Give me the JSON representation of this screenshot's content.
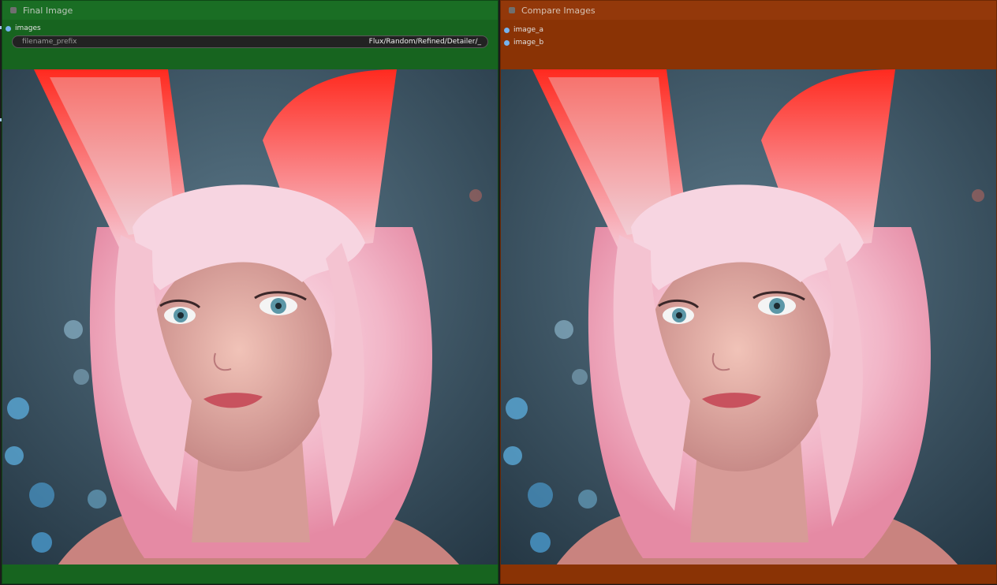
{
  "final_node": {
    "title": "Final Image",
    "input_slot": "images",
    "widget": {
      "name": "filename_prefix",
      "value": "Flux/Random/Refined/Detailer/_"
    },
    "preview_image": "portrait-pink-hair-fox-ears"
  },
  "compare_node": {
    "title": "Compare Images",
    "input_slots": [
      "image_a",
      "image_b"
    ],
    "preview_image": "portrait-pink-hair-fox-ears"
  },
  "colors": {
    "final_node_body": "#17641f",
    "compare_node_body": "#8a3305",
    "slot_dot": "#75b3ef"
  }
}
